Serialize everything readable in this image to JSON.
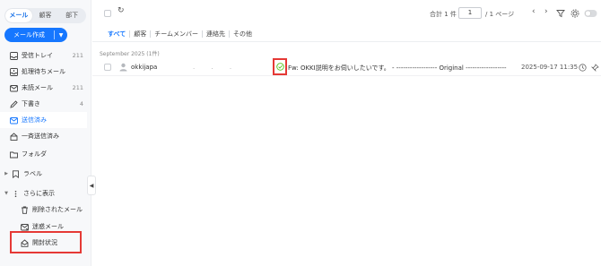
{
  "tabs": [
    {
      "label": "メール",
      "active": true
    },
    {
      "label": "顧客",
      "active": false
    },
    {
      "label": "部下",
      "active": false
    }
  ],
  "compose": {
    "label": "メール作成"
  },
  "nav": {
    "inbox": {
      "label": "受信トレイ",
      "count": "211"
    },
    "pending": {
      "label": "処理待ちメール"
    },
    "unread": {
      "label": "未読メール",
      "count": "211"
    },
    "drafts": {
      "label": "下書き",
      "count": "4"
    },
    "sent": {
      "label": "送信済み"
    },
    "bulk_sent": {
      "label": "一斉送信済み"
    },
    "folders": {
      "label": "フォルダ"
    },
    "labels": {
      "label": "ラベル"
    },
    "more": {
      "label": "さらに表示"
    },
    "deleted": {
      "label": "削除されたメール"
    },
    "spam": {
      "label": "迷惑メール"
    },
    "open_status": {
      "label": "開封状況"
    }
  },
  "toolbar": {
    "total": "合計 1 件",
    "page_value": "1",
    "page_total": "/ 1 ページ"
  },
  "filters": [
    "すべて",
    "顧客",
    "チームメンバー",
    "連絡先",
    "その他"
  ],
  "group_label": "September 2025 (1件)",
  "emails": [
    {
      "sender": "okkijapa",
      "subject": "Fw: OKKI説明をお伺いしたいです。 - ------------------ Original ------------------",
      "date": "2025-09-17 11:35"
    }
  ],
  "colors": {
    "accent": "#1677ff",
    "highlight": "#e53935",
    "opened": "#52c41a"
  }
}
